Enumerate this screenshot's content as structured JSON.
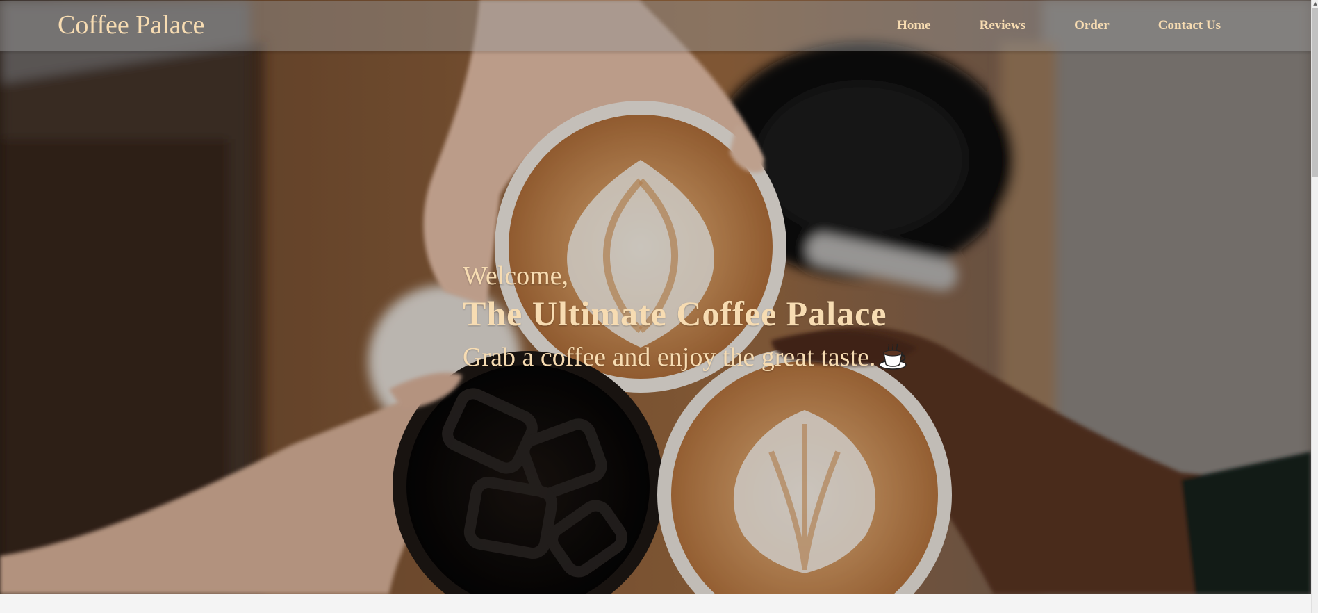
{
  "navbar": {
    "brand": "Coffee Palace",
    "links": [
      {
        "label": "Home"
      },
      {
        "label": "Reviews"
      },
      {
        "label": "Order"
      },
      {
        "label": "Contact Us"
      }
    ]
  },
  "hero": {
    "welcome": "Welcome,",
    "headline": "The Ultimate Coffee Palace",
    "tagline": "Grab a coffee and enjoy the great taste.",
    "tagline_icon": "coffee-cup-emoji",
    "background_image": "hands-toasting-coffee-cups"
  },
  "colors": {
    "accent_text": "#f7dcb2",
    "navbar_bg": "rgba(150,150,150,0.45)",
    "page_bg": "#f4f4f4"
  }
}
